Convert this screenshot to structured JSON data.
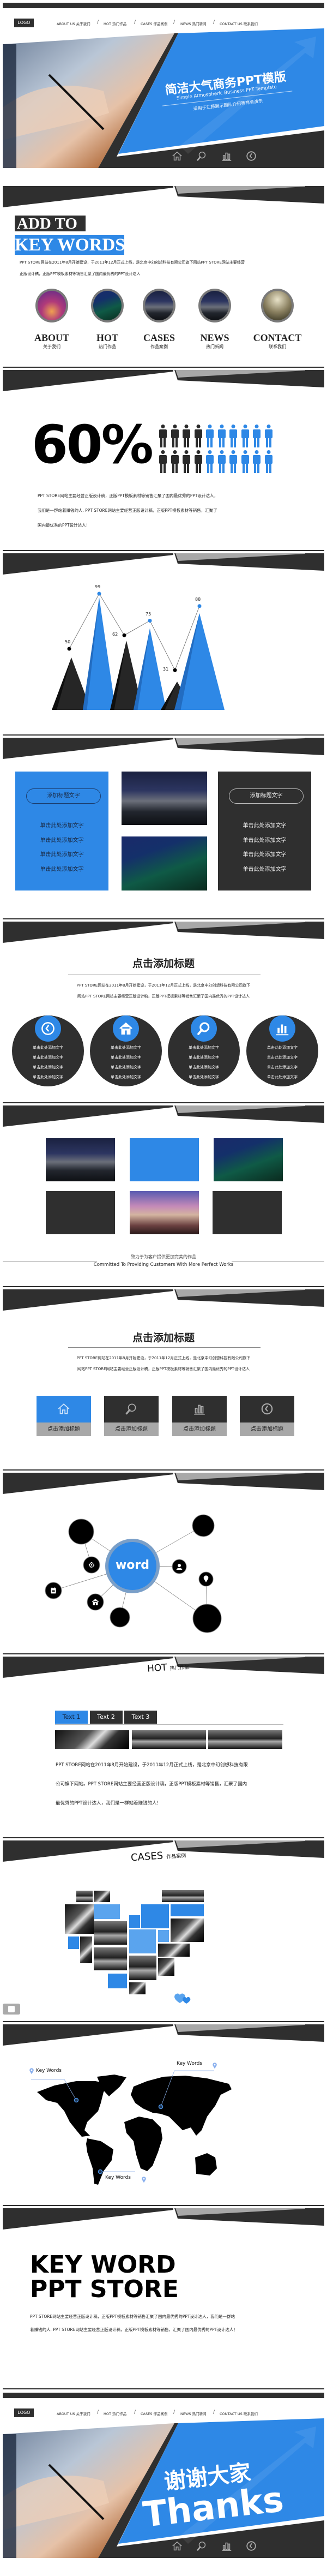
{
  "colors": {
    "blue": "#2e88e6",
    "blue_light": "#5aa4ee",
    "dark": "#2f2f2f",
    "gray": "#a8a8a8"
  },
  "nav": {
    "logo": "LOGO",
    "items": [
      {
        "en": "ABOUT US",
        "cn": "关于我们"
      },
      {
        "en": "HOT",
        "cn": "热门作品"
      },
      {
        "en": "CASES",
        "cn": "作品案例"
      },
      {
        "en": "NEWS",
        "cn": "热门新闻"
      },
      {
        "en": "CONTACT US",
        "cn": "联系我们"
      }
    ],
    "separator": "/"
  },
  "cover": {
    "title": "简洁大气商务PPT模版",
    "subtitle_en": "Simple  Atmospheric  Business  PPT Template",
    "subtitle_cn": "适用于汇报展示团队介绍等商务演示",
    "icons": [
      "home-icon",
      "search-icon",
      "chart-icon",
      "clock-icon"
    ]
  },
  "intro": {
    "line1": "ADD TO",
    "line2": "KEY WORDS",
    "text": [
      "PPT STORE网站在2011年8月开始建设，于2011年12月正式上线，是北京中幻创想科技有限公司旗下网站PPT STORE网站主要经营",
      "正版设计稿，正版PPT模板素材等销售汇聚了国内最优秀的PPT设计达人"
    ],
    "items": [
      {
        "en": "ABOUT",
        "cn": "关于我们"
      },
      {
        "en": "HOT",
        "cn": "热门作品"
      },
      {
        "en": "CASES",
        "cn": "作品案例"
      },
      {
        "en": "NEWS",
        "cn": "热门新闻"
      },
      {
        "en": "CONTACT",
        "cn": "联系我们"
      }
    ]
  },
  "stat": {
    "value": "60%",
    "people_per_row": 10,
    "rows": 2,
    "dark_per_row": 4,
    "blue_per_row": 6,
    "text": [
      "PPT STORE网站主要经营正版设计稿，正版PPT模板素材等销售汇聚了国内最优秀的PPT设计达人，",
      "我们是一群站着赚钱的人. PPT STORE网站主要经营正版设计稿，正版PPT模板素材等销售，汇聚了",
      "国内最优秀的PPT设计达人！"
    ]
  },
  "chart_data": {
    "type": "line",
    "values": [
      50,
      99,
      62,
      75,
      31,
      88
    ],
    "labels": [
      "50",
      "99",
      "62",
      "75",
      "31",
      "88"
    ],
    "series_colors": [
      "#262626",
      "#2e88e6",
      "#262626",
      "#2e88e6",
      "#262626",
      "#2e88e6"
    ],
    "grid": false,
    "ylim": [
      0,
      100
    ]
  },
  "boxes": {
    "left": {
      "title": "添加标题文字",
      "items": [
        "单击此处添加文字",
        "单击此处添加文字",
        "单击此处添加文字",
        "单击此处添加文字"
      ]
    },
    "right": {
      "title": "添加标题文字",
      "items": [
        "单击此处添加文字",
        "单击此处添加文字",
        "单击此处添加文字",
        "单击此处添加文字"
      ]
    }
  },
  "circles": {
    "title": "点击添加标题",
    "text": [
      "PPT STORE网站在2011年8月开始建设，于2011年12月正式上线，是北京中幻创想科技有限公司旗下",
      "网站PPT STORE网站主要经营正版设计稿，正版PPT模板素材等销售汇聚了国内最优秀的PPT设计达人"
    ],
    "items": [
      {
        "icon": "clock-icon",
        "lines": [
          "单击此处添加文字",
          "单击此处添加文字",
          "单击此处添加文字",
          "单击此处添加文字"
        ]
      },
      {
        "icon": "home-icon",
        "lines": [
          "单击此处添加文字",
          "单击此处添加文字",
          "单击此处添加文字",
          "单击此处添加文字"
        ]
      },
      {
        "icon": "search-icon",
        "lines": [
          "单击此处添加文字",
          "单击此处添加文字",
          "单击此处添加文字",
          "单击此处添加文字"
        ]
      },
      {
        "icon": "chart-icon",
        "lines": [
          "单击此处添加文字",
          "单击此处添加文字",
          "单击此处添加文字",
          "单击此处添加文字"
        ]
      }
    ]
  },
  "gallery": {
    "caption_cn": "致力于为客户提供更加完美的作品",
    "caption_en": "Committed To Providing Customers With More Perfect Works"
  },
  "tiles": {
    "title": "点击添加标题",
    "text": [
      "PPT STORE网站在2011年8月开始建设，于2011年12月正式上线，是北京中幻创想科技有限公司旗下",
      "网站PPT STORE网站主要经营正版设计稿，正版PPT模板素材等销售汇聚了国内最优秀的PPT设计达人"
    ],
    "items": [
      {
        "icon": "home-icon",
        "label": "点击添加标题",
        "active": true
      },
      {
        "icon": "search-icon",
        "label": "点击添加标题",
        "active": false
      },
      {
        "icon": "chart-icon",
        "label": "点击添加标题",
        "active": false
      },
      {
        "icon": "clock-icon",
        "label": "点击添加标题",
        "active": false
      }
    ]
  },
  "network": {
    "center": "word",
    "icons": [
      "gear-icon",
      "notepad-icon",
      "home-icon",
      "user-icon",
      "location-icon"
    ]
  },
  "hot": {
    "label_en": "HOT",
    "label_cn": "热门作品",
    "tabs": [
      "Text 1",
      "Text 2",
      "Text 3"
    ],
    "active_tab": 0,
    "text": [
      "PPT STORE网站在2011年8月开始建设，于2011年12月正式上线，是北京中幻创想科技有限",
      "公司旗下网站。PPT STORE网站主要经营正版设计稿，正版PPT模板素材等销售，汇聚了国内",
      "最优秀的PPT设计达人，我们是一群站着赚钱的人！"
    ]
  },
  "cases": {
    "label_en": "CASES",
    "label_cn": "作品案例"
  },
  "map": {
    "labels": [
      "Key Words",
      "Key Words",
      "Key Words"
    ]
  },
  "keyword": {
    "line1": "KEY WORD",
    "line2": "PPT STORE",
    "text": [
      "PPT STORE网站主要经营正版设计稿，正版PPT模板素材等销售汇聚了国内最优秀的PPT设计达人，我们是一群站",
      "着赚钱的人. PPT STORE网站主要经营正版设计稿，正版PPT模板素材等销售，汇聚了国内最优秀的PPT设计达人！"
    ]
  },
  "thanks": {
    "title_cn": "谢谢大家",
    "title_en": "Thanks"
  }
}
